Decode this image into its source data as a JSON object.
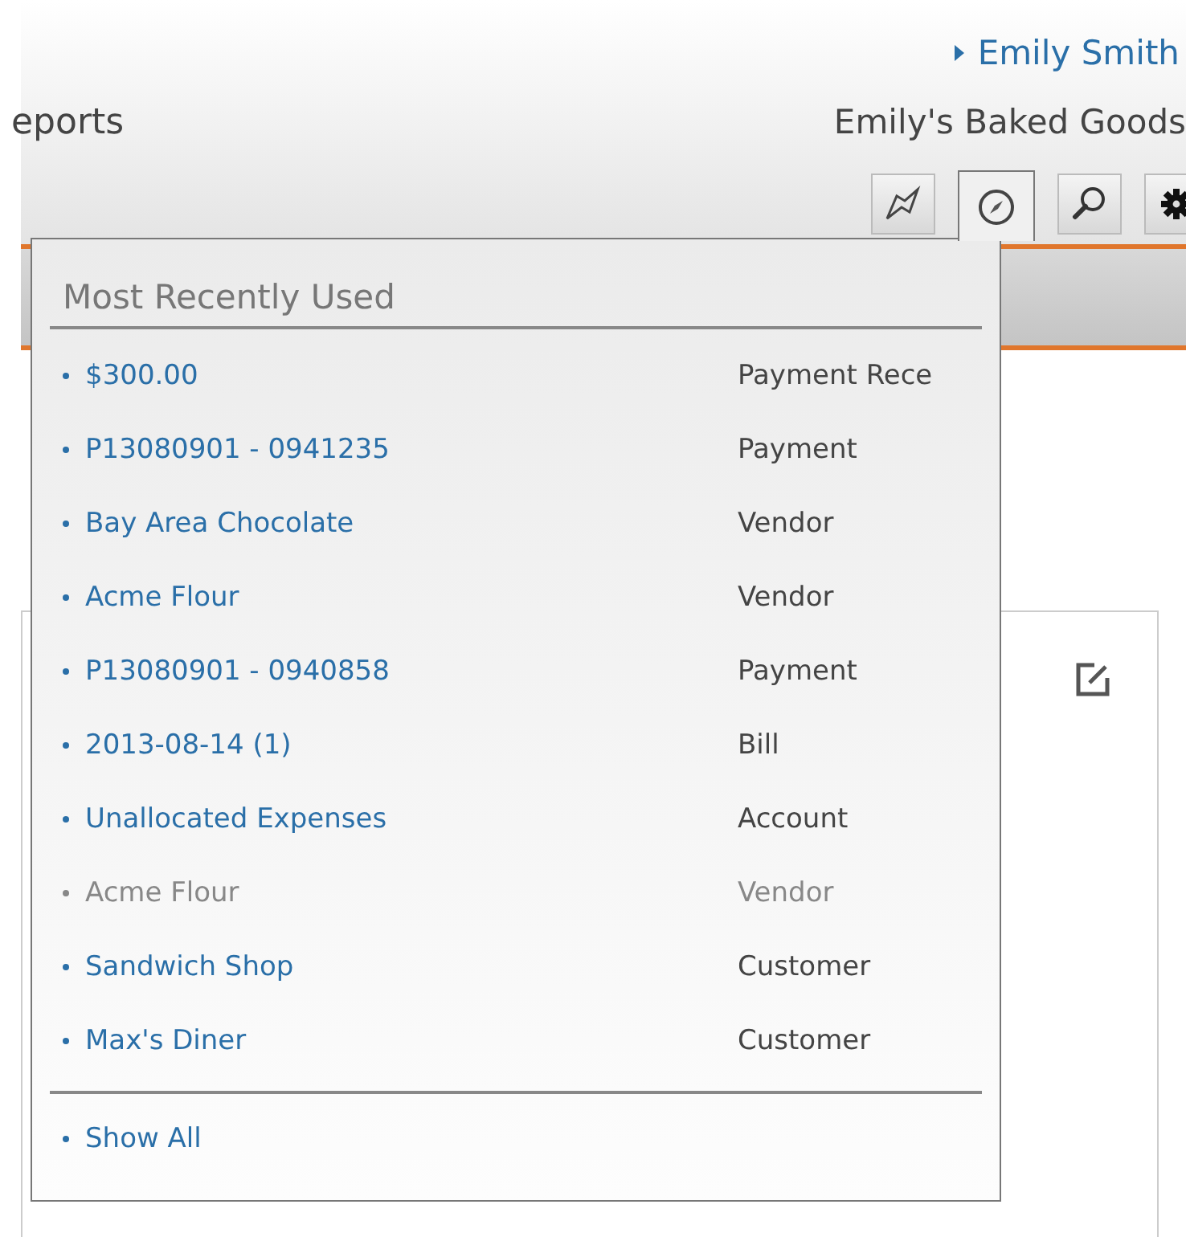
{
  "header": {
    "nav_fragment": "eports",
    "user_link": "Emily Smith",
    "company": "Emily's Baked Goods"
  },
  "toolbar": [
    {
      "kind": "map",
      "selected": false
    },
    {
      "kind": "compass",
      "selected": true
    },
    {
      "kind": "search",
      "selected": false
    },
    {
      "kind": "gear",
      "selected": false
    }
  ],
  "recent_menu": {
    "title": "Most Recently Used",
    "items": [
      {
        "name": "$300.00",
        "type": "Payment Rece",
        "dimmed": false
      },
      {
        "name": "P13080901 - 0941235",
        "type": "Payment",
        "dimmed": false
      },
      {
        "name": "Bay Area Chocolate",
        "type": "Vendor",
        "dimmed": false
      },
      {
        "name": "Acme Flour",
        "type": "Vendor",
        "dimmed": false
      },
      {
        "name": "P13080901 - 0940858",
        "type": "Payment",
        "dimmed": false
      },
      {
        "name": "2013-08-14 (1)",
        "type": "Bill",
        "dimmed": false
      },
      {
        "name": "Unallocated Expenses",
        "type": "Account",
        "dimmed": false
      },
      {
        "name": "Acme Flour",
        "type": "Vendor",
        "dimmed": true
      },
      {
        "name": "Sandwich Shop",
        "type": "Customer",
        "dimmed": false
      },
      {
        "name": "Max's Diner",
        "type": "Customer",
        "dimmed": false
      }
    ],
    "show_all": "Show All"
  }
}
